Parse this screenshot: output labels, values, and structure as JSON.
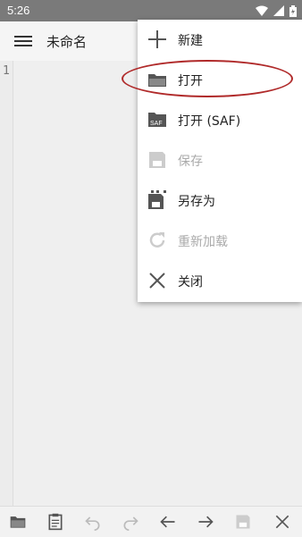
{
  "status_bar": {
    "time": "5:26"
  },
  "app_bar": {
    "title": "未命名"
  },
  "editor": {
    "line_numbers": [
      "1"
    ]
  },
  "menu": {
    "items": [
      {
        "label": "新建",
        "icon": "plus-icon",
        "enabled": true
      },
      {
        "label": "打开",
        "icon": "folder-open-icon",
        "enabled": true,
        "highlighted": true
      },
      {
        "label": "打开 (SAF)",
        "icon": "saf-folder-icon",
        "enabled": true
      },
      {
        "label": "保存",
        "icon": "save-icon",
        "enabled": false
      },
      {
        "label": "另存为",
        "icon": "save-as-icon",
        "enabled": true
      },
      {
        "label": "重新加载",
        "icon": "reload-icon",
        "enabled": false
      },
      {
        "label": "关闭",
        "icon": "close-icon",
        "enabled": true
      }
    ]
  },
  "bottom_toolbar": {
    "buttons": [
      {
        "icon": "open-folder-icon",
        "enabled": true
      },
      {
        "icon": "clipboard-icon",
        "enabled": true
      },
      {
        "icon": "undo-icon",
        "enabled": false
      },
      {
        "icon": "redo-icon",
        "enabled": false
      },
      {
        "icon": "arrow-left-icon",
        "enabled": true
      },
      {
        "icon": "arrow-right-icon",
        "enabled": true
      },
      {
        "icon": "save-icon",
        "enabled": false
      },
      {
        "icon": "close-icon",
        "enabled": true
      }
    ]
  },
  "colors": {
    "highlight": "#b02a2a",
    "disabled": "#aaaaaa",
    "statusbar": "#7a7a7a"
  }
}
